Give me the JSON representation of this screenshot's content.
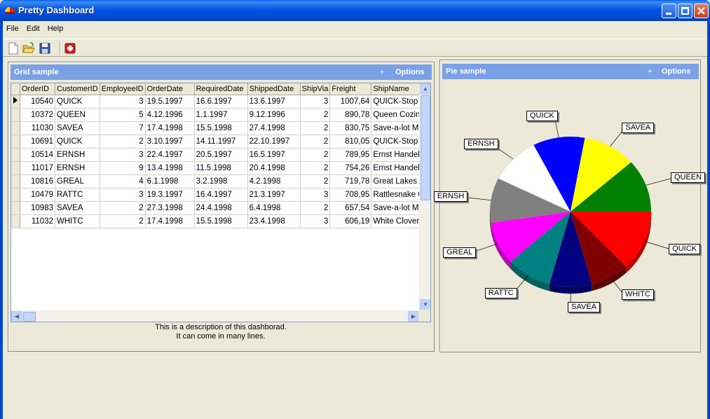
{
  "window": {
    "title": "Pretty Dashboard"
  },
  "menu": [
    "File",
    "Edit",
    "Help"
  ],
  "toolbar": {
    "icons": [
      "new-file-icon",
      "open-folder-icon",
      "save-disk-icon",
      "red-action-icon"
    ]
  },
  "grid_panel": {
    "title": "Grid sample",
    "plus": "+",
    "options": "Options",
    "columns": [
      "OrderID",
      "CustomerID",
      "EmployeeID",
      "OrderDate",
      "RequiredDate",
      "ShippedDate",
      "ShipVia",
      "Freight",
      "ShipName"
    ],
    "rows": [
      [
        "10540",
        "QUICK",
        "3",
        "19.5.1997",
        "16.6.1997",
        "13.6.1997",
        "3",
        "1007,64",
        "QUICK-Stop"
      ],
      [
        "10372",
        "QUEEN",
        "5",
        "4.12.1996",
        "1.1.1997",
        "9.12.1996",
        "2",
        "890,78",
        "Queen Cozinh"
      ],
      [
        "11030",
        "SAVEA",
        "7",
        "17.4.1998",
        "15.5.1998",
        "27.4.1998",
        "2",
        "830,75",
        "Save-a-lot Ma"
      ],
      [
        "10691",
        "QUICK",
        "2",
        "3.10.1997",
        "14.11.1997",
        "22.10.1997",
        "2",
        "810,05",
        "QUICK-Stop"
      ],
      [
        "10514",
        "ERNSH",
        "3",
        "22.4.1997",
        "20.5.1997",
        "16.5.1997",
        "2",
        "789,95",
        "Ernst Handel"
      ],
      [
        "11017",
        "ERNSH",
        "9",
        "13.4.1998",
        "11.5.1998",
        "20.4.1998",
        "2",
        "754,26",
        "Ernst Handel"
      ],
      [
        "10816",
        "GREAL",
        "4",
        "6.1.1998",
        "3.2.1998",
        "4.2.1998",
        "2",
        "719,78",
        "Great Lakes F"
      ],
      [
        "10479",
        "RATTC",
        "3",
        "19.3.1997",
        "16.4.1997",
        "21.3.1997",
        "3",
        "708,95",
        "Rattlesnake C"
      ],
      [
        "10983",
        "SAVEA",
        "2",
        "27.3.1998",
        "24.4.1998",
        "6.4.1998",
        "2",
        "657,54",
        "Save-a-lot Ma"
      ],
      [
        "11032",
        "WHITC",
        "2",
        "17.4.1998",
        "15.5.1998",
        "23.4.1998",
        "3",
        "606,19",
        "White Clover"
      ]
    ],
    "description_line1": "This is a description of this dashborad.",
    "description_line2": "It can come in many lines."
  },
  "pie_panel": {
    "title": "Pie sample",
    "plus": "+",
    "options": "Options"
  },
  "chart_data": {
    "type": "pie",
    "title": "",
    "slices": [
      {
        "label": "QUICK",
        "value": 1007.64,
        "color": "#ff0000"
      },
      {
        "label": "WHITC",
        "value": 606.19,
        "color": "#800000"
      },
      {
        "label": "SAVEA",
        "value": 657.54,
        "color": "#000080"
      },
      {
        "label": "RATTC",
        "value": 708.95,
        "color": "#008080"
      },
      {
        "label": "GREAL",
        "value": 719.78,
        "color": "#ff00ff"
      },
      {
        "label": "ERNSH",
        "value": 754.26,
        "color": "#808080"
      },
      {
        "label": "ERNSH",
        "value": 789.95,
        "color": "#ffffff"
      },
      {
        "label": "QUICK",
        "value": 810.05,
        "color": "#0000ff"
      },
      {
        "label": "SAVEA",
        "value": 830.75,
        "color": "#ffff00"
      },
      {
        "label": "QUEEN",
        "value": 890.78,
        "color": "#008000"
      }
    ]
  }
}
